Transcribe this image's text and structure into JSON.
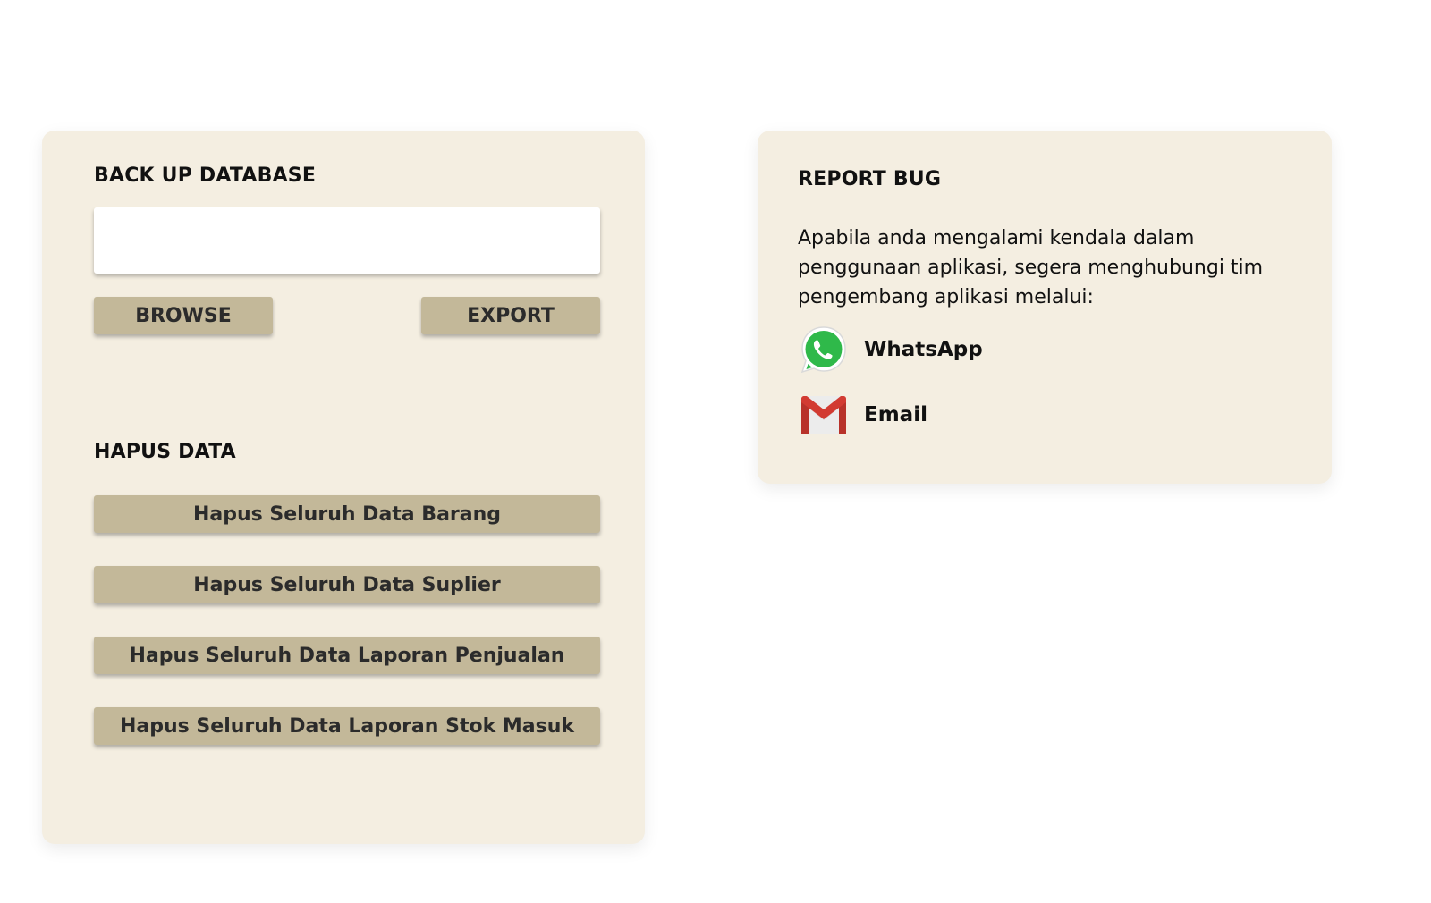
{
  "backup": {
    "title": "BACK UP DATABASE",
    "path_value": "",
    "path_placeholder": "",
    "browse_label": "BROWSE",
    "export_label": "EXPORT"
  },
  "hapus": {
    "title": "HAPUS DATA",
    "buttons": [
      {
        "label": "Hapus Seluruh Data Barang"
      },
      {
        "label": "Hapus Seluruh Data Suplier"
      },
      {
        "label": "Hapus Seluruh Data Laporan Penjualan"
      },
      {
        "label": "Hapus Seluruh Data Laporan Stok Masuk"
      }
    ]
  },
  "report": {
    "title": "REPORT BUG",
    "description": "Apabila anda mengalami kendala dalam penggunaan aplikasi, segera menghubungi tim pengembang aplikasi melalui:",
    "contacts": [
      {
        "label": "WhatsApp",
        "icon": "whatsapp-icon"
      },
      {
        "label": "Email",
        "icon": "gmail-icon"
      }
    ]
  },
  "colors": {
    "card_bg": "#f4eee1",
    "button_bg": "#c3b899",
    "whatsapp_green": "#2fb94a",
    "gmail_red": "#d23b32"
  }
}
